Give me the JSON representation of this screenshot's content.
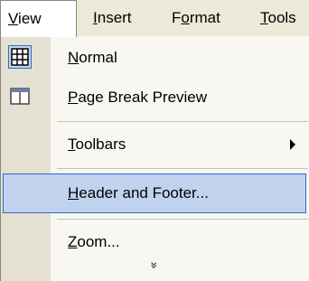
{
  "menubar": {
    "items": [
      {
        "prefix": "",
        "acc": "V",
        "rest": "iew"
      },
      {
        "prefix": "",
        "acc": "I",
        "rest": "nsert"
      },
      {
        "prefix": "F",
        "acc": "o",
        "rest": "rmat"
      },
      {
        "prefix": "",
        "acc": "T",
        "rest": "ools"
      }
    ]
  },
  "view_menu": {
    "items": [
      {
        "prefix": "",
        "acc": "N",
        "rest": "ormal",
        "icon": "normal-view-icon"
      },
      {
        "prefix": "",
        "acc": "P",
        "rest": "age Break Preview",
        "icon": "page-break-preview-icon"
      },
      {
        "prefix": "",
        "acc": "T",
        "rest": "oolbars",
        "has_submenu": true
      },
      {
        "prefix": "",
        "acc": "H",
        "rest": "eader and Footer...",
        "highlighted": true
      },
      {
        "prefix": "",
        "acc": "Z",
        "rest": "oom..."
      }
    ],
    "expand_glyph": "»"
  },
  "colors": {
    "menubar_bg": "#ece9d8",
    "gutter_bg": "#e4e1d2",
    "menu_bg": "#f8f7f2",
    "highlight_bg": "#c1d2ee",
    "highlight_border": "#316ac5"
  }
}
